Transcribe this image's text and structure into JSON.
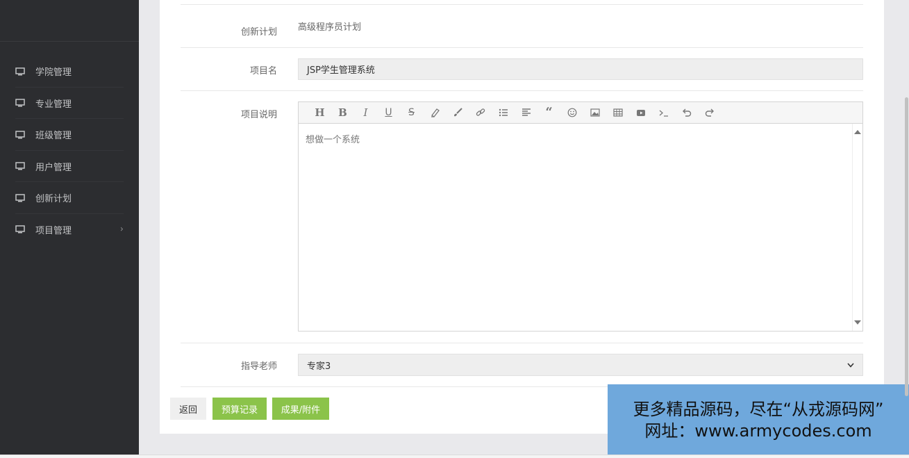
{
  "sidebar": {
    "items": [
      {
        "label": "学院管理",
        "icon": "monitor-icon"
      },
      {
        "label": "专业管理",
        "icon": "monitor-icon"
      },
      {
        "label": "班级管理",
        "icon": "monitor-icon"
      },
      {
        "label": "用户管理",
        "icon": "monitor-icon"
      },
      {
        "label": "创新计划",
        "icon": "monitor-icon"
      },
      {
        "label": "项目管理",
        "icon": "monitor-icon",
        "arrow": "›"
      }
    ]
  },
  "form": {
    "plan_label": "创新计划",
    "plan_value": "高级程序员计划",
    "name_label": "项目名",
    "name_value": "JSP学生管理系统",
    "desc_label": "项目说明",
    "desc_value": "想做一个系统",
    "teacher_label": "指导老师",
    "teacher_value": "专家3"
  },
  "toolbar": {
    "icons": [
      "heading-icon",
      "bold-icon",
      "italic-icon",
      "underline-icon",
      "strikethrough-icon",
      "eraser-icon",
      "brush-icon",
      "link-icon",
      "unordered-list-icon",
      "align-left-icon",
      "quote-icon",
      "emoji-icon",
      "image-icon",
      "table-icon",
      "video-icon",
      "code-icon",
      "undo-icon",
      "redo-icon"
    ]
  },
  "buttons": {
    "back": "返回",
    "budget": "预算记录",
    "results": "成果/附件"
  },
  "watermark": {
    "line1": "更多精品源码，尽在“从戎源码网”",
    "line2": "网址：www.armycodes.com"
  },
  "colors": {
    "sidebar_bg": "#2c2d30",
    "accent_green": "#8bc34a",
    "watermark_bg": "#6fa8dc"
  }
}
